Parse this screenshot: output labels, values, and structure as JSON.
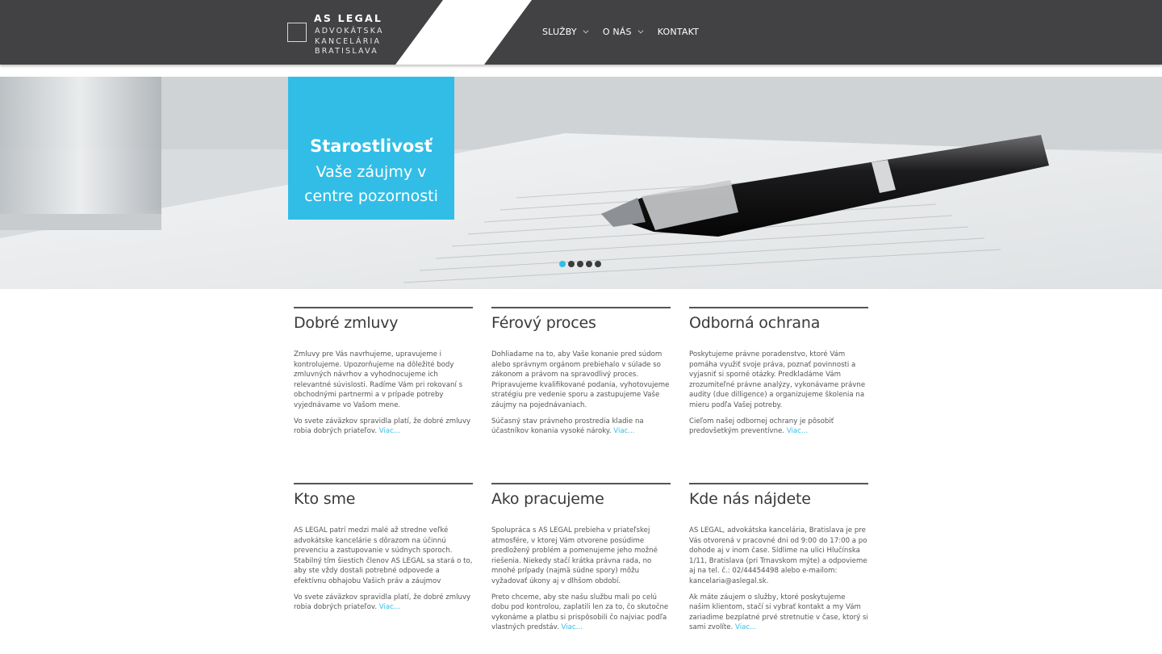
{
  "brand": {
    "name": "AS LEGAL",
    "sub1": "ADVOKÁTSKA",
    "sub2": "KANCELÁRIA",
    "sub3": "BRATISLAVA"
  },
  "nav": {
    "items": [
      {
        "label": "SLUŽBY"
      },
      {
        "label": "O NÁS"
      },
      {
        "label": "KONTAKT"
      }
    ]
  },
  "hero": {
    "title": "Starostlivosť",
    "line1": "Vaše záujmy v",
    "line2": "centre pozornosti",
    "slide_count": 5,
    "active_slide": 1
  },
  "colors": {
    "header": "#424244",
    "accent": "#31bde6"
  },
  "columns": [
    {
      "title": "Dobré zmluvy",
      "p1": "Zmluvy pre Vás navrhujeme, upravujeme i kontrolujeme. Upozorňujeme na dôležité body zmluvných návrhov a vyhodnocujeme ich relevantné súvislosti. Radíme Vám pri rokovaní s obchodnými partnermi a v prípade potreby vyjednávame vo Vašom mene.",
      "p2": "Vo svete záväzkov spravidla platí, že dobré zmluvy robia dobrých priateľov.",
      "more": "Viac..."
    },
    {
      "title": "Férový proces",
      "p1": "Dohliadame na to, aby Vaše konanie pred súdom alebo správnym orgánom prebiehalo v súlade so zákonom a právom na spravodlivý proces. Pripravujeme kvalifikované podania, vyhotovujeme stratégiu pre vedenie sporu a zastupujeme Vaše záujmy na pojednávaniach.",
      "p2": "Súčasný stav právneho prostredia kladie na účastníkov konania vysoké nároky.",
      "more": "Viac..."
    },
    {
      "title": "Odborná ochrana",
      "p1": "Poskytujeme právne poradenstvo, ktoré Vám pomáha využiť svoje práva, poznať povinnosti a vyjasniť si sporné otázky. Predkladáme Vám zrozumiteľné právne analýzy, vykonávame právne audity (due dilligence) a organizujeme školenia na mieru podľa Vašej potreby.",
      "p2": "Cieľom našej odbornej ochrany je pôsobiť predovšetkým preventívne.",
      "more": "Viac..."
    },
    {
      "title": "Kto sme",
      "p1": "AS LEGAL patrí medzi malé až stredne veľké advokátske kancelárie s dôrazom na účinnú prevenciu a zastupovanie v súdnych sporoch. Stabilný tím šiestich členov AS LEGAL sa stará o to, aby ste vždy dostali potrebné odpovede a efektívnu obhajobu Vašich práv a záujmov",
      "p2": "Vo svete záväzkov spravidla platí, že dobré zmluvy robia dobrých priateľov.",
      "more": "Viac..."
    },
    {
      "title": "Ako pracujeme",
      "p1": "Spolupráca s AS LEGAL prebieha v priateľskej atmosfére, v ktorej Vám otvorene posúdime predložený problém a pomenujeme jeho možné riešenia. Niekedy stačí krátka právna rada, no mnohé prípady (najmä súdne spory) môžu vyžadovať úkony aj v dlhšom období.",
      "p2": "Preto chceme, aby ste našu službu mali po celú dobu pod kontrolou, zaplatili len za to, čo skutočne vykonáme a platbu si prispôsobili čo najviac podľa vlastných predstáv.",
      "more": "Viac..."
    },
    {
      "title": "Kde nás nájdete",
      "p1": "AS LEGAL, advokátska kancelária, Bratislava je pre Vás otvorená v pracovné dni od 9:00 do 17:00 a po dohode aj v inom čase. Sídlime na ulici Hlučínska 1/11, Bratislava (pri Trnavskom mýte) a odpovieme aj na tel. č.: 02/44454498 alebo e-mailom: kancelaria@aslegal.sk.",
      "p2": "Ak máte záujem o služby, ktoré poskytujeme našim klientom, stačí si vybrať kontakt a my Vám zariadime bezplatné prvé stretnutie v čase, ktorý si sami zvolíte.",
      "more": "Viac..."
    }
  ]
}
